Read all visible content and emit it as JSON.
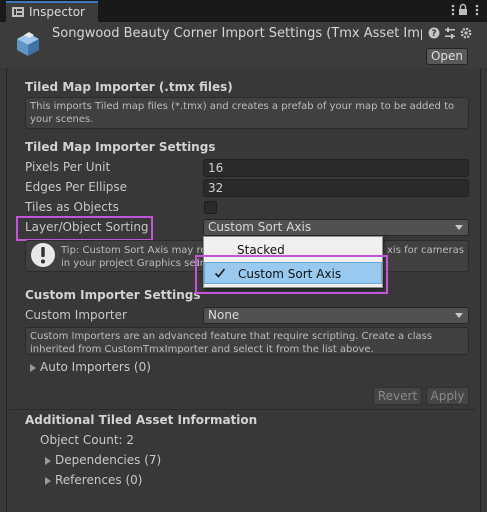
{
  "window": {
    "tab_label": "Inspector"
  },
  "header": {
    "title": "Songwood Beauty Corner Import Settings (Tmx Asset Impo",
    "open_label": "Open"
  },
  "tiled_map_importer": {
    "heading": "Tiled Map Importer (.tmx files)",
    "description": "This imports Tiled map files (*.tmx) and creates a prefab of your map to be added to your scenes."
  },
  "settings": {
    "heading": "Tiled Map Importer Settings",
    "pixels_per_unit_label": "Pixels Per Unit",
    "pixels_per_unit_value": "16",
    "edges_per_ellipse_label": "Edges Per Ellipse",
    "edges_per_ellipse_value": "32",
    "tiles_as_objects_label": "Tiles as Objects",
    "tiles_as_objects_checked": false,
    "layer_sorting_label": "Layer/Object Sorting",
    "layer_sorting_value": "Custom Sort Axis",
    "tip_left": "Tip: Custom Sort Axis may req",
    "tip_left2": "in your project Graphics set",
    "tip_right": "xis for cameras",
    "tip_right2": "in"
  },
  "sorting_dropdown": {
    "options": [
      "Stacked",
      "Custom Sort Axis"
    ],
    "selected": "Custom Sort Axis"
  },
  "custom_importer": {
    "heading": "Custom Importer Settings",
    "label": "Custom Importer",
    "value": "None",
    "description": "Custom Importers are an advanced feature that require scripting. Create a class inherited from CustomTmxImporter and select it from the list above.",
    "auto_importers": "Auto Importers (0)"
  },
  "actions": {
    "revert_label": "Revert",
    "apply_label": "Apply"
  },
  "additional": {
    "heading": "Additional Tiled Asset Information",
    "object_count": "Object Count: 2",
    "dependencies": "Dependencies (7)",
    "references": "References (0)"
  },
  "colors": {
    "highlight": "#c454d8",
    "selection": "#99c9ef",
    "tab_accent": "#3a79bb"
  }
}
